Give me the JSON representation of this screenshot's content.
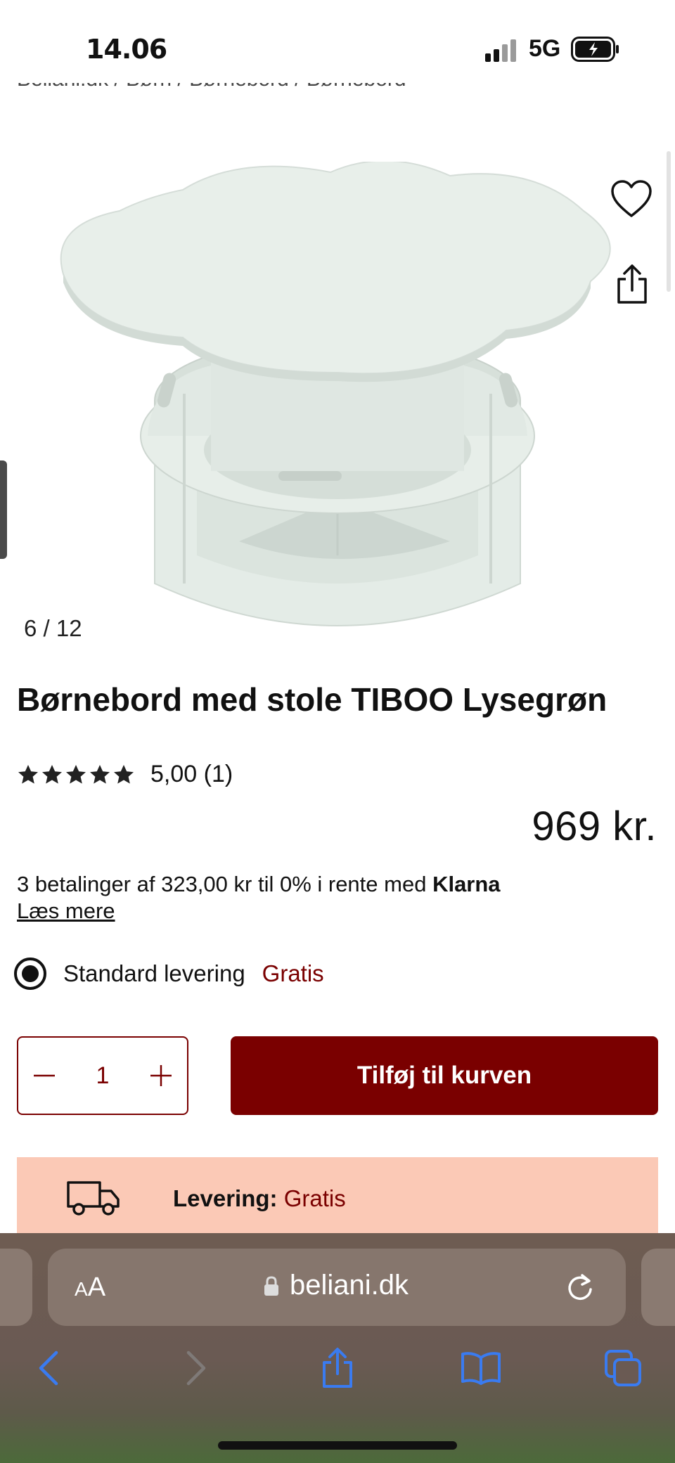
{
  "status_bar": {
    "time": "14.06",
    "network": "5G"
  },
  "breadcrumb": {
    "text": "Beliani.dk / Børn / Børnebord / Børnebord"
  },
  "gallery": {
    "counter": "6 / 12",
    "product_color": "#e3ebe6"
  },
  "product": {
    "title": "Børnebord med stole TIBOO Lysegrøn",
    "rating_stars": 5,
    "rating_text": "5,00 (1)",
    "price": "969 kr."
  },
  "payment": {
    "installments_text": "3 betalinger af 323,00 kr til 0% i rente med ",
    "provider": "Klarna",
    "read_more": "Læs mere"
  },
  "delivery_option": {
    "label": "Standard levering",
    "price": "Gratis",
    "selected": true
  },
  "cart": {
    "quantity": "1",
    "add_label": "Tilføj til kurven"
  },
  "banner": {
    "label": "Levering:",
    "value": "Gratis"
  },
  "browser": {
    "text_size_small": "A",
    "text_size_big": "A",
    "domain": "beliani.dk"
  },
  "colors": {
    "brand": "#7a0000",
    "banner_bg": "#fbc9b6",
    "ios_blue": "#3a7bf0"
  }
}
